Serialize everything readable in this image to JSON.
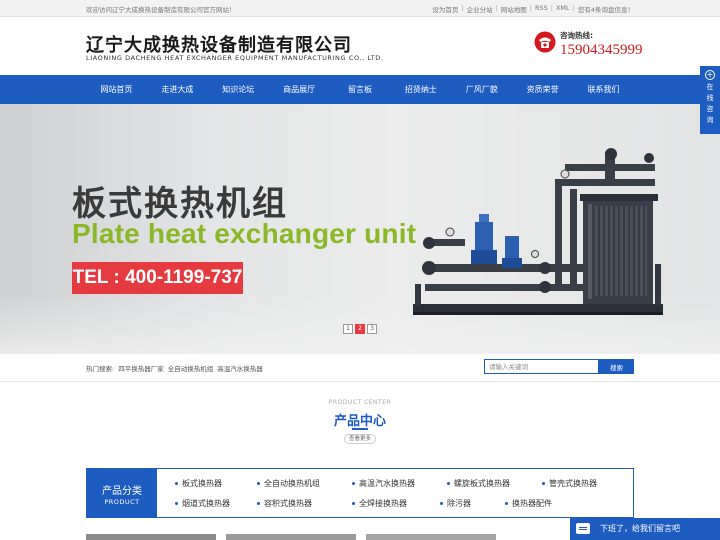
{
  "topbar": {
    "welcome": "欢迎访问辽宁大成换热设备制造有限公司官方网站！",
    "links": [
      "设为首页",
      "企业分站",
      "网站地图",
      "RSS",
      "XML",
      "您有4条询盘信息！"
    ]
  },
  "header": {
    "logo_cn": "辽宁大成换热设备制造有限公司",
    "logo_en": "LIAONING DACHENG HEAT EXCHANGER EQUIPMENT MANUFACTURING CO., LTD.",
    "hotline_label": "咨询热线:",
    "hotline_number": "15904345999"
  },
  "nav": {
    "items": [
      "网站首页",
      "走进大成",
      "知识论坛",
      "商品展厅",
      "留言板",
      "招贤纳士",
      "厂风厂貌",
      "资质荣誉",
      "联系我们"
    ]
  },
  "banner": {
    "title_cn": "板式换热机组",
    "title_en": "Plate heat exchanger unit",
    "tel": "TEL : 400-1199-737",
    "pages": [
      "1",
      "2",
      "3"
    ],
    "active_page": 2
  },
  "hot_search": {
    "label": "热门搜索:",
    "terms": [
      "四平换热器厂家",
      "全自动换热机组",
      "高温汽水换热器"
    ],
    "placeholder": "请输入关键词",
    "button": "搜索"
  },
  "section": {
    "title_en": "PRODUCT CENTER",
    "title_cn": "产品中心",
    "more": "查看更多"
  },
  "categories": {
    "title_cn": "产品分类",
    "title_en": "PRODUCT",
    "items": [
      "板式换热器",
      "全自动换热机组",
      "高温汽水换热器",
      "螺旋板式换热器",
      "管壳式换热器",
      "烟道式换热器",
      "容积式换热器",
      "全焊接换热器",
      "除污器",
      "换热器配件"
    ]
  },
  "float": {
    "consult": "在线咨询",
    "leave_message": "下班了，给我们留言吧"
  },
  "colors": {
    "brand_blue": "#1d5cc0",
    "accent_red": "#e53a3f",
    "hotline_red": "#d5181d",
    "green": "#8ab827"
  }
}
